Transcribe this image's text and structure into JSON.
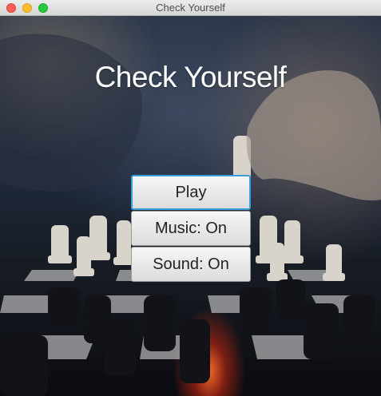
{
  "window": {
    "title": "Check Yourself"
  },
  "main": {
    "title": "Check Yourself",
    "buttons": {
      "play": "Play",
      "music": "Music: On",
      "sound": "Sound: On"
    }
  },
  "colors": {
    "focus_ring": "#3a9fd8",
    "title_text": "#ffffff"
  },
  "background": {
    "depicts": "chess-game-photo"
  }
}
